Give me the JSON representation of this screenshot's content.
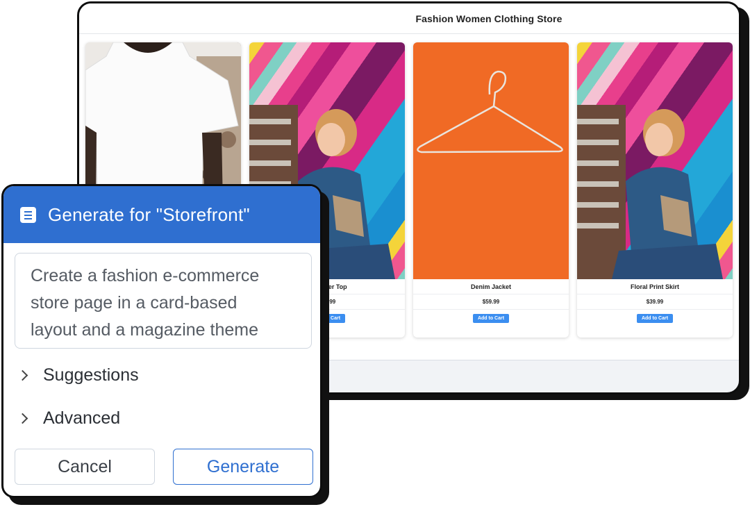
{
  "store": {
    "title": "Fashion Women Clothing Store",
    "products": [
      {
        "name": "",
        "price": "",
        "cart_label": ""
      },
      {
        "name": "Shoulder Top",
        "price": "$49.99",
        "cart_label": "Add to Cart"
      },
      {
        "name": "Denim Jacket",
        "price": "$59.99",
        "cart_label": "Add to Cart"
      },
      {
        "name": "Floral Print Skirt",
        "price": "$39.99",
        "cart_label": "Add to Cart"
      }
    ]
  },
  "dialog": {
    "title": "Generate for  \"Storefront\"",
    "prompt": "Create a fashion e-commerce\nstore page in a card-based\nlayout and a magazine theme",
    "suggestions_label": "Suggestions",
    "advanced_label": "Advanced",
    "cancel_label": "Cancel",
    "generate_label": "Generate"
  },
  "colors": {
    "accent": "#2f6fd0",
    "cart_button": "#3b8ef0",
    "hanger_background": "#f06a25"
  },
  "icons": [
    "document-icon",
    "chevron-right-icon",
    "hanger-icon"
  ]
}
